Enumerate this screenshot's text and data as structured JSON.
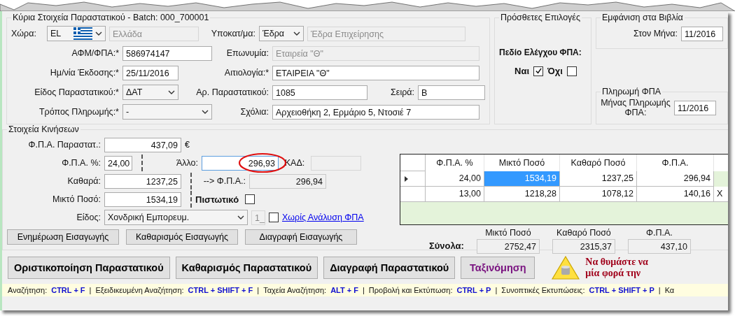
{
  "main": {
    "title": "Κύρια Στοιχεία Παραστατικού - Batch: 000_700001",
    "lines": [
      {
        "items": [
          {
            "kind": "label",
            "text": "Χώρα:"
          },
          {
            "kind": "combo",
            "value": "EL",
            "flag": true
          },
          {
            "kind": "text",
            "value": "Ελλάδα",
            "disabled": true
          },
          {
            "kind": "label",
            "text": "Υποκατ/μα:"
          },
          {
            "kind": "combo",
            "value": "Έδρα"
          },
          {
            "kind": "text",
            "value": "Έδρα Επιχείρησης",
            "disabled": true
          }
        ]
      },
      {
        "items": [
          {
            "kind": "label",
            "text": "ΑΦΜ/ΦΠΑ:*"
          },
          {
            "kind": "text",
            "value": "586974147",
            "disabled": false
          },
          {
            "kind": "label",
            "text": "Επωνυμία:"
          },
          {
            "kind": "text",
            "value": "Εταιρεία \"Θ\"",
            "disabled": true
          }
        ]
      },
      {
        "items": [
          {
            "kind": "label",
            "text": "Ημ/νία Έκδοσης:*"
          },
          {
            "kind": "text",
            "value": "25/11/2016",
            "disabled": false
          },
          {
            "kind": "label",
            "text": "Αιτιολογία:*"
          },
          {
            "kind": "text",
            "value": "ΕΤΑΙΡΕΙΑ \"Θ\"",
            "disabled": false
          }
        ]
      },
      {
        "items": [
          {
            "kind": "label",
            "text": "Είδος Παραστατικού:*"
          },
          {
            "kind": "combo",
            "value": "ΔΑΤ"
          },
          {
            "kind": "label",
            "text": "Αρ. Παραστατικού:"
          },
          {
            "kind": "text",
            "value": "1085",
            "disabled": false
          },
          {
            "kind": "label",
            "text": "Σειρά:"
          },
          {
            "kind": "text",
            "value": "Β",
            "disabled": false
          }
        ]
      },
      {
        "items": [
          {
            "kind": "label",
            "text": "Τρόπος Πληρωμής:*"
          },
          {
            "kind": "combo",
            "value": "-"
          },
          {
            "kind": "label",
            "text": "Σχόλια:"
          },
          {
            "kind": "text",
            "value": "Αρχειοθήκη 2, Ερμάριο 5, Ντοσιέ 7",
            "disabled": false
          }
        ]
      }
    ]
  },
  "options": {
    "title": "Πρόσθετες Επιλογές",
    "vat_check_label": "Πεδίο Ελέγχου ΦΠΑ:",
    "choices": [
      {
        "label": "Ναι",
        "checked": true
      },
      {
        "label": "Όχι",
        "checked": false
      }
    ]
  },
  "books": {
    "title": "Εμφάνιση στα Βιβλία",
    "month_label": "Στον Μήνα:",
    "month_value": "11/2016"
  },
  "vat_payment": {
    "title": "Πληρωμή ΦΠΑ",
    "month_label": "Μήνας Πληρωμής ΦΠΑ:",
    "month_value": "11/2016"
  },
  "movements": {
    "title": "Στοιχεία Κινήσεων",
    "vat_doc": {
      "label": "Φ.Π.Α. Παραστατ.:",
      "value": "437,09",
      "currency": "€"
    },
    "vat_rate": {
      "label": "Φ.Π.Α. %:",
      "value": "24,00"
    },
    "net": {
      "label": "Καθαρά:",
      "value": "1237,25"
    },
    "gross": {
      "label": "Μικτό Ποσό:",
      "value": "1534,19"
    },
    "other": {
      "label": "Άλλο:",
      "value": "296,93",
      "circled": true
    },
    "kad": {
      "label": "ΚΑΔ:",
      "disabled": true
    },
    "vat": {
      "label": "--> Φ.Π.Α.:",
      "value": "296,94"
    },
    "credit": {
      "label": "Πιστωτικό",
      "checked": false
    },
    "type": {
      "label": "Είδος:",
      "value": "Χονδρική Εμπορευμ."
    },
    "code": {
      "value": "1_"
    },
    "no_analysis": {
      "label": "Χωρίς Ανάλυση ΦΠΑ",
      "checked": false
    },
    "buttons": [
      "Ενημέρωση Εισαγωγής",
      "Καθαρισμός Εισαγωγής",
      "Διαγραφή Εισαγωγής"
    ]
  },
  "grid": {
    "columns": [
      "Φ.Π.Α. %",
      "Μικτό Ποσό",
      "Καθαρό Ποσό",
      "Φ.Π.Α."
    ],
    "rows": [
      {
        "selected": true,
        "cells": [
          {
            "text": "24,00",
            "selected": false
          },
          {
            "text": "1534,19",
            "selected": true
          },
          {
            "text": "1237,25",
            "selected": false
          },
          {
            "text": "296,94",
            "selected": false
          }
        ]
      },
      {
        "selected": false,
        "cells": [
          {
            "text": "13,00",
            "selected": false
          },
          {
            "text": "1218,28",
            "selected": false
          },
          {
            "text": "1078,12",
            "selected": false
          },
          {
            "text": "140,16",
            "selected": false
          },
          {
            "text": "Χ",
            "selected": false
          }
        ]
      }
    ]
  },
  "totals": {
    "label": "Σύνολα:",
    "items": [
      {
        "label": "Μικτό Ποσό",
        "value": "2752,47"
      },
      {
        "label": "Καθαρό Ποσό",
        "value": "2315,37"
      },
      {
        "label": "Φ.Π.Α.",
        "value": "437,10"
      }
    ]
  },
  "actions": [
    {
      "label": "Οριστικοποίηση Παραστατικού",
      "kind": "normal"
    },
    {
      "label": "Καθαρισμός Παραστατικού",
      "kind": "normal"
    },
    {
      "label": "Διαγραφή Παραστατικού",
      "kind": "normal"
    },
    {
      "label": "Ταξινόμηση",
      "kind": "accent"
    }
  ],
  "reminder": [
    "Να θυμάστε να",
    "μία φορά την"
  ],
  "shortcut_separator": "|",
  "shortcuts": [
    {
      "label": "Αναζήτηση:",
      "keys": "CTRL + F"
    },
    {
      "label": "Εξειδικευμένη Αναζήτηση:",
      "keys": "CTRL + SHIFT + F"
    },
    {
      "label": "Ταχεία Αναζήτηση:",
      "keys": "ALT + F"
    },
    {
      "label": "Προβολή και Εκτύπωση:",
      "keys": "CTRL + P"
    },
    {
      "label": "Συνοπτικές Εκτυπώσεις:",
      "keys": "CTRL + SHIFT + P"
    },
    {
      "label": "Κα"
    }
  ]
}
